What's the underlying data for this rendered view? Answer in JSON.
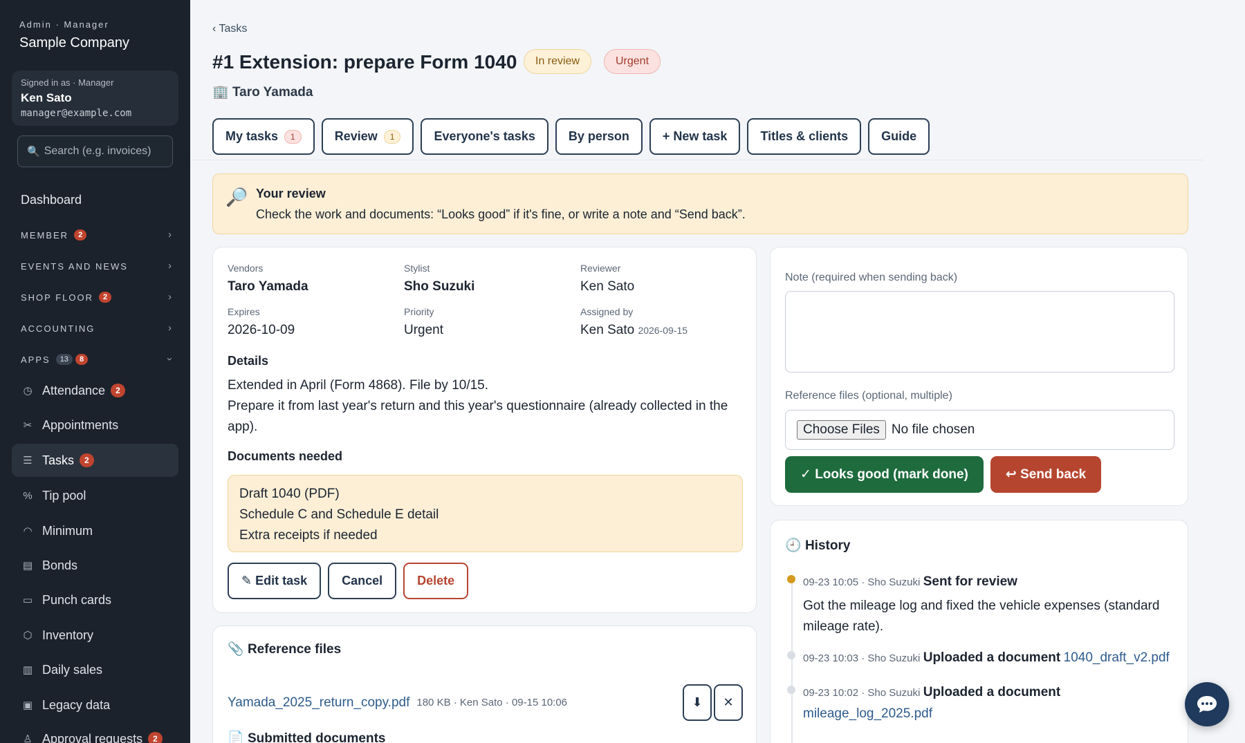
{
  "sidebar": {
    "role_line": "Admin · Manager",
    "company": "Sample Company",
    "user": {
      "label": "Signed in as · Manager",
      "name": "Ken Sato",
      "email": "manager@example.com"
    },
    "search_placeholder": "Search (e.g. invoices)",
    "dashboard": "Dashboard",
    "sections": [
      {
        "label": "MEMBER",
        "badge": "2"
      },
      {
        "label": "EVENTS AND NEWS"
      },
      {
        "label": "SHOP FLOOR",
        "badge": "2"
      },
      {
        "label": "ACCOUNTING"
      },
      {
        "label": "APPS",
        "count": "13",
        "badge": "8"
      }
    ],
    "items": [
      {
        "label": "Attendance",
        "icon": "clock-icon",
        "badge": "2"
      },
      {
        "label": "Appointments",
        "icon": "scissors-icon"
      },
      {
        "label": "Tasks",
        "icon": "checklist-icon",
        "badge": "2"
      },
      {
        "label": "Tip pool",
        "icon": "percent-icon"
      },
      {
        "label": "Minimum",
        "icon": "gauge-icon"
      },
      {
        "label": "Bonds",
        "icon": "receipt-icon"
      },
      {
        "label": "Punch cards",
        "icon": "card-icon"
      },
      {
        "label": "Inventory",
        "icon": "box-icon"
      },
      {
        "label": "Daily sales",
        "icon": "bar-chart-icon"
      },
      {
        "label": "Legacy data",
        "icon": "archive-icon"
      },
      {
        "label": "Approval requests",
        "icon": "stamp-icon",
        "badge": "2"
      }
    ]
  },
  "header": {
    "back": "‹ Tasks",
    "title": "#1 Extension: prepare Form 1040",
    "status": "In review",
    "priority_pill": "Urgent",
    "client_icon": "🏢",
    "client": "Taro Yamada"
  },
  "tabs": [
    {
      "label": "My tasks",
      "count": "1"
    },
    {
      "label": "Review",
      "count": "1"
    },
    {
      "label": "Everyone's tasks"
    },
    {
      "label": "By person"
    },
    {
      "label": "+ New task"
    },
    {
      "label": "Titles & clients"
    },
    {
      "label": "Guide"
    }
  ],
  "alert": {
    "icon": "🔎",
    "title": "Your review",
    "text": "Check the work and documents: “Looks good” if it's fine, or write a note and “Send back”."
  },
  "details": {
    "vendors_label": "Vendors",
    "vendors": "Taro Yamada",
    "stylist_label": "Stylist",
    "stylist": "Sho Suzuki",
    "reviewer_label": "Reviewer",
    "reviewer": "Ken Sato",
    "expires_label": "Expires",
    "expires": "2026-10-09",
    "priority_label": "Priority",
    "priority": "Urgent",
    "assigned_label": "Assigned by",
    "assigned": "Ken Sato",
    "assigned_date": "2026-09-15",
    "details_heading": "Details",
    "details_line1": "Extended in April (Form 4868). File by 10/15.",
    "details_line2": "Prepare it from last year's return and this year's questionnaire (already collected in the app).",
    "docs_heading": "Documents needed",
    "docs": [
      "Draft 1040 (PDF)",
      "Schedule C and Schedule E detail",
      "Extra receipts if needed"
    ],
    "edit": "✎ Edit task",
    "cancel": "Cancel",
    "delete": "Delete"
  },
  "review": {
    "note_label": "Note (required when sending back)",
    "files_label": "Reference files (optional, multiple)",
    "choose": "Choose Files",
    "no_file": "No file chosen",
    "approve": "✓ Looks good (mark done)",
    "send_back": "↩ Send back"
  },
  "history": {
    "icon": "🕘",
    "title": "History",
    "entries": [
      {
        "meta": "09-23 10:05 · Sho Suzuki",
        "action": "Sent for review",
        "body": "Got the mileage log and fixed the vehicle expenses (standard mileage rate)."
      },
      {
        "meta": "09-23 10:03 · Sho Suzuki",
        "action": "Uploaded a document",
        "link": "1040_draft_v2.pdf"
      },
      {
        "meta": "09-23 10:02 · Sho Suzuki",
        "action": "Uploaded a document",
        "link": "mileage_log_2025.pdf"
      }
    ]
  },
  "files": {
    "icon": "📎",
    "title": "Reference files",
    "items": [
      {
        "name": "Yamada_2025_return_copy.pdf",
        "meta": "180 KB · Ken Sato · 09-15 10:06"
      }
    ],
    "download": "⬇",
    "remove": "✕",
    "submitted_icon": "📄",
    "submitted": "Submitted documents"
  },
  "chat_icon": "chat-bubble-icon"
}
